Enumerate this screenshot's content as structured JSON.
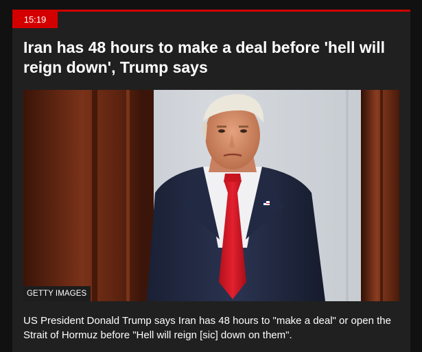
{
  "post": {
    "time": "15:19",
    "headline": "Iran has 48 hours to make a deal before 'hell will reign down', Trump says",
    "image": {
      "credit": "GETTY IMAGES"
    },
    "summary": "US President Donald Trump says Iran has 48 hours to \"make a deal\" or open the Strait of Hormuz before \"Hell will reign [sic] down on them\"."
  },
  "colors": {
    "accent": "#d40000",
    "card_background": "#202020",
    "page_background": "#111111",
    "text": "#ffffff"
  }
}
